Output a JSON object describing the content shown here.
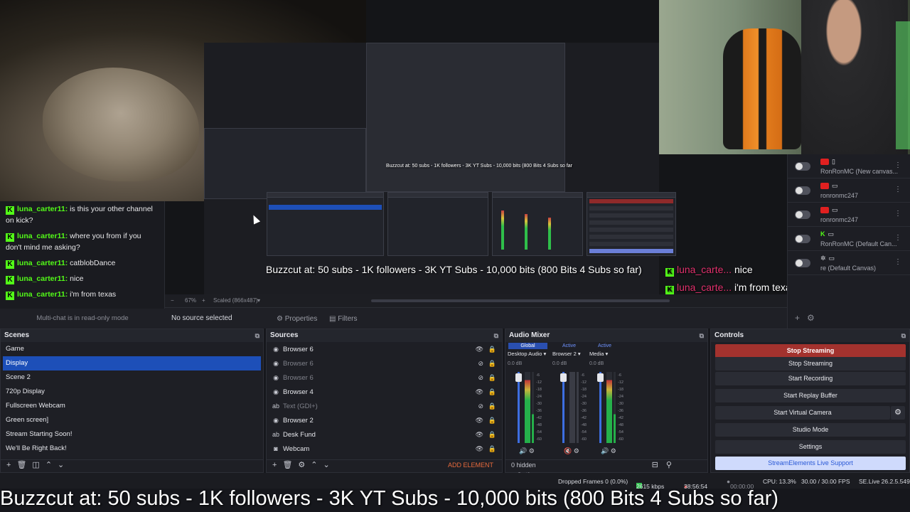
{
  "overlay": {
    "banner_text": "Buzzcut at: 50 subs - 1K followers - 3K YT Subs - 10,000 bits (800 Bits 4 Subs so far)",
    "nested_banner": "Buzzcut at: 50 subs - 1K followers - 3K YT Subs - 10,000 bits (800 Bits 4 Subs so far",
    "chat_overlay": [
      {
        "user": "luna_carte...",
        "message": "nice"
      },
      {
        "user": "luna_carte...",
        "message": "i'm from texas"
      }
    ]
  },
  "multichat": {
    "messages": [
      {
        "user": "luna_carter11:",
        "text": "is this your other channel on kick?"
      },
      {
        "user": "luna_carter11:",
        "text": "where you from if you don't mind me asking?"
      },
      {
        "user": "luna_carter11:",
        "text": "catblobDance"
      },
      {
        "user": "luna_carter11:",
        "text": "nice"
      },
      {
        "user": "luna_carter11:",
        "text": "i'm from texas"
      }
    ],
    "footer": "Multi-chat is in read-only mode"
  },
  "canvases": [
    {
      "label": "RonRonMC (New canvas..."
    },
    {
      "label": "ronronmc247"
    },
    {
      "label": "ronronmc247"
    },
    {
      "label": "RonRonMC (Default Can..."
    },
    {
      "label": "re (Default Canvas)"
    }
  ],
  "preview": {
    "zoom": "67%",
    "scaled": "Scaled (866x487)",
    "no_source": "No source selected",
    "properties_label": "Properties",
    "filters_label": "Filters"
  },
  "scenes": {
    "title": "Scenes",
    "items": [
      "Game",
      "Display",
      "Scene 2",
      "720p Display",
      "Fullscreen Webcam",
      "Green screen]",
      "Stream Starting Soon!",
      "We'll Be Right Back!"
    ]
  },
  "sources": {
    "title": "Sources",
    "items": [
      "Browser 6",
      "Browser 6",
      "Browser 6",
      "Browser 4",
      "Text (GDI+)",
      "Browser 2",
      "Desk Fund",
      "Webcam"
    ],
    "add_element": "ADD ELEMENT"
  },
  "mixer": {
    "title": "Audio Mixer",
    "tabs": [
      "Global",
      "Active",
      "Active"
    ],
    "channels": [
      {
        "name": "Desktop Audio",
        "db": "0.0 dB"
      },
      {
        "name": "Browser 2",
        "db": "0.0 dB"
      },
      {
        "name": "Media",
        "db": "0.0 dB"
      }
    ],
    "hidden": "0 hidden",
    "options": "Options"
  },
  "controls": {
    "title": "Controls",
    "buttons": [
      "Stop Streaming",
      "Stop Streaming",
      "Start Recording",
      "Start Replay Buffer",
      "Start Virtual Camera",
      "Studio Mode",
      "Settings",
      "StreamElements Live Support"
    ]
  },
  "status": {
    "dropped": "Dropped Frames 0 (0.0%)",
    "bitrate": "2615 kbps",
    "stream_time": "38:56:54",
    "rec_time": "00:00:00",
    "cpu": "CPU: 13.3%",
    "fps": "30.00 / 30.00 FPS",
    "version": "SE.Live 26.2.5.549"
  }
}
